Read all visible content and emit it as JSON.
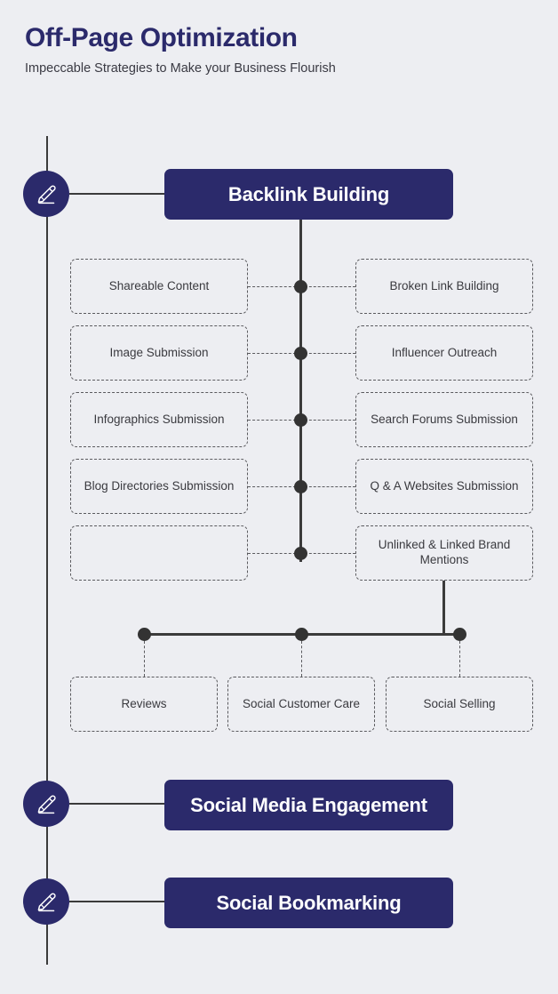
{
  "header": {
    "title": "Off-Page Optimization",
    "subtitle": "Impeccable Strategies to Make your Business Flourish"
  },
  "colors": {
    "background": "#edeef2",
    "navy": "#2b2a6b",
    "line": "#3b3b3b",
    "dot": "#333333",
    "dashed_border": "#5a5a5e",
    "body_text": "#3a3a3f"
  },
  "main_nodes": [
    {
      "label": "Backlink Building",
      "icon": "pencil-icon"
    },
    {
      "label": "Social Media Engagement",
      "icon": "pencil-icon"
    },
    {
      "label": "Social Bookmarking",
      "icon": "pencil-icon"
    }
  ],
  "backlink_children": {
    "left": [
      {
        "label": "Shareable Content"
      },
      {
        "label": "Image Submission"
      },
      {
        "label": "Infographics Submission"
      },
      {
        "label": "Blog Directories Submission"
      },
      {
        "label": ""
      }
    ],
    "right": [
      {
        "label": "Broken Link Building"
      },
      {
        "label": "Influencer Outreach"
      },
      {
        "label": "Search Forums Submission"
      },
      {
        "label": "Q & A Websites Submission"
      },
      {
        "label": "Unlinked & Linked Brand Mentions"
      }
    ]
  },
  "branch_children": [
    {
      "label": "Reviews"
    },
    {
      "label": "Social Customer Care"
    },
    {
      "label": "Social Selling"
    }
  ]
}
